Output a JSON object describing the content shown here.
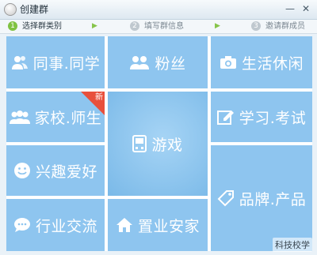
{
  "window": {
    "title": "创建群",
    "minimize": "—",
    "close": "✕"
  },
  "steps": [
    {
      "num": "1",
      "label": "选择群类别"
    },
    {
      "num": "2",
      "label": "填写群信息"
    },
    {
      "num": "3",
      "label": "邀请群成员"
    }
  ],
  "step_arrow": "▶",
  "tiles": {
    "classmates": {
      "label": "同事.同学",
      "icon": "users-icon"
    },
    "fans": {
      "label": "粉丝",
      "icon": "group-icon"
    },
    "life": {
      "label": "生活休闲",
      "icon": "camera-icon"
    },
    "school": {
      "label": "家校.师生",
      "icon": "family-icon",
      "badge": "新"
    },
    "game": {
      "label": "游戏",
      "icon": "gamepad-icon"
    },
    "study": {
      "label": "学习.考试",
      "icon": "edit-icon"
    },
    "hobby": {
      "label": "兴趣爱好",
      "icon": "smile-icon"
    },
    "brand": {
      "label": "品牌.产品",
      "icon": "tag-icon"
    },
    "industry": {
      "label": "行业交流",
      "icon": "chat-icon"
    },
    "realestate": {
      "label": "置业安家",
      "icon": "home-icon"
    }
  },
  "watermark": "科技校学",
  "colors": {
    "tile": "#8ec5ef",
    "badge": "#e8503c",
    "active_step": "#7fc241"
  }
}
